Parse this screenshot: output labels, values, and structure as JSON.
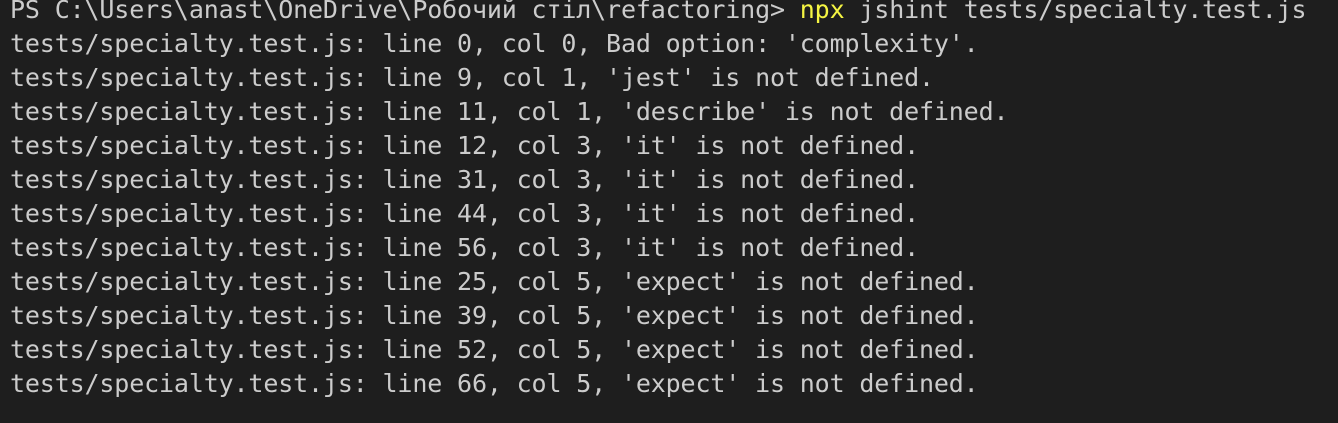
{
  "terminal": {
    "prompt": "PS C:\\Users\\anast\\OneDrive\\Робочий стіл\\refactoring> ",
    "command": {
      "name": "npx",
      "args": " jshint tests/specialty.test.js"
    },
    "output": [
      "tests/specialty.test.js: line 0, col 0, Bad option: 'complexity'.",
      "tests/specialty.test.js: line 9, col 1, 'jest' is not defined.",
      "tests/specialty.test.js: line 11, col 1, 'describe' is not defined.",
      "tests/specialty.test.js: line 12, col 3, 'it' is not defined.",
      "tests/specialty.test.js: line 31, col 3, 'it' is not defined.",
      "tests/specialty.test.js: line 44, col 3, 'it' is not defined.",
      "tests/specialty.test.js: line 56, col 3, 'it' is not defined.",
      "tests/specialty.test.js: line 25, col 5, 'expect' is not defined.",
      "tests/specialty.test.js: line 39, col 5, 'expect' is not defined.",
      "tests/specialty.test.js: line 52, col 5, 'expect' is not defined.",
      "tests/specialty.test.js: line 66, col 5, 'expect' is not defined."
    ]
  },
  "colors": {
    "background": "#1e1e1e",
    "text": "#cccccc",
    "command_highlight": "#f5f543"
  }
}
